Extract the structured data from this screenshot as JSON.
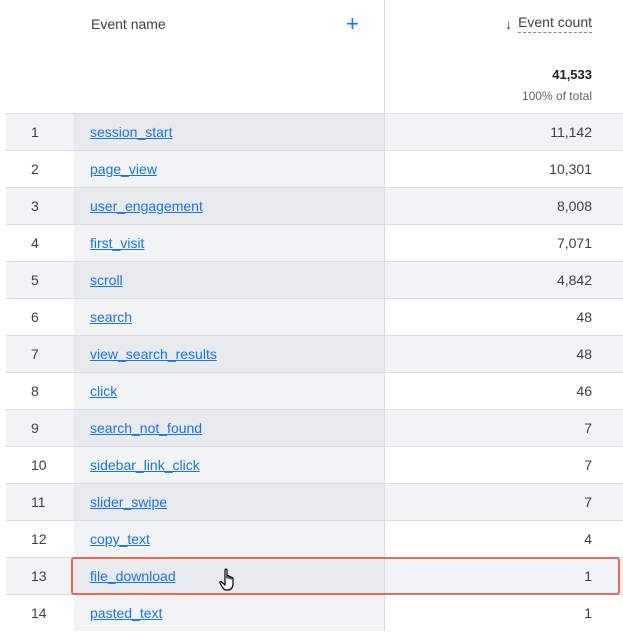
{
  "header": {
    "event_name_label": "Event name",
    "add_icon": "plus-icon",
    "sort_icon": "arrow-down-icon",
    "event_count_label": "Event count",
    "total": "41,533",
    "total_pct": "100% of total"
  },
  "rows": [
    {
      "num": "1",
      "name": "session_start",
      "count": "11,142"
    },
    {
      "num": "2",
      "name": "page_view",
      "count": "10,301"
    },
    {
      "num": "3",
      "name": "user_engagement",
      "count": "8,008"
    },
    {
      "num": "4",
      "name": "first_visit",
      "count": "7,071"
    },
    {
      "num": "5",
      "name": "scroll",
      "count": "4,842"
    },
    {
      "num": "6",
      "name": "search",
      "count": "48"
    },
    {
      "num": "7",
      "name": "view_search_results",
      "count": "48"
    },
    {
      "num": "8",
      "name": "click",
      "count": "46"
    },
    {
      "num": "9",
      "name": "search_not_found",
      "count": "7"
    },
    {
      "num": "10",
      "name": "sidebar_link_click",
      "count": "7"
    },
    {
      "num": "11",
      "name": "slider_swipe",
      "count": "7"
    },
    {
      "num": "12",
      "name": "copy_text",
      "count": "4"
    },
    {
      "num": "13",
      "name": "file_download",
      "count": "1"
    },
    {
      "num": "14",
      "name": "pasted_text",
      "count": "1"
    }
  ],
  "colors": {
    "link": "#1a73e8",
    "highlight_border": "#ea6b52"
  }
}
